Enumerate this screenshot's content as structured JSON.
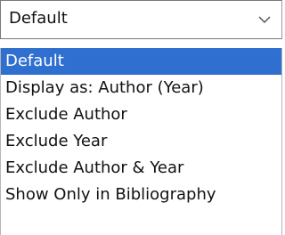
{
  "select": {
    "value": "Default",
    "icon": "chevron-down-icon"
  },
  "options": [
    {
      "label": "Default",
      "selected": true
    },
    {
      "label": "Display as: Author (Year)",
      "selected": false
    },
    {
      "label": "Exclude Author",
      "selected": false
    },
    {
      "label": "Exclude Year",
      "selected": false
    },
    {
      "label": "Exclude Author & Year",
      "selected": false
    },
    {
      "label": "Show Only in Bibliography",
      "selected": false
    }
  ],
  "colors": {
    "selection": "#2f6fd0",
    "selection_text": "#ffffff",
    "text": "#111111",
    "border": "#7a7a7a"
  }
}
